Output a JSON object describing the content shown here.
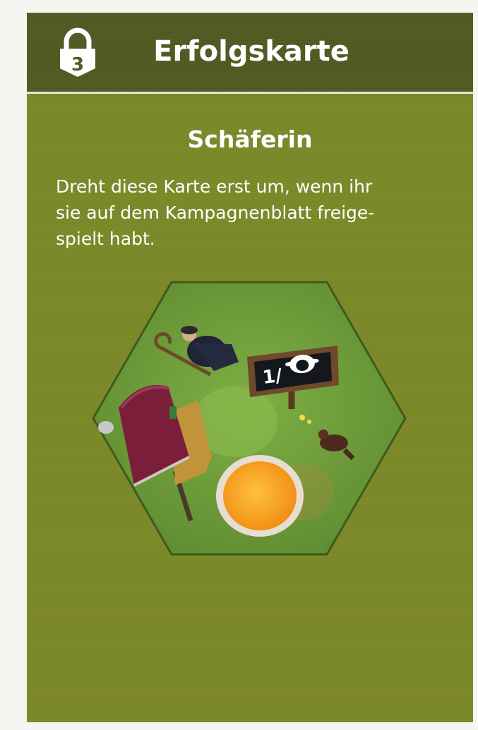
{
  "header": {
    "lock_number": "3",
    "title": "Erfolgskarte"
  },
  "card": {
    "name": "Schäferin",
    "description_lines": [
      "Dreht diese Karte erst um, wenn ihr",
      "sie auf dem Kampagnenblatt freige-",
      "spielt habt."
    ]
  },
  "sign": {
    "text": "1/"
  },
  "colors": {
    "header_bg": "#535c24",
    "card_bg": "#7d8a2a",
    "hex_bg": "#6d9a3a",
    "wagon": "#7a1e3a",
    "hay": "#f5a623"
  },
  "icons": [
    "lock-icon",
    "sheep-icon"
  ]
}
